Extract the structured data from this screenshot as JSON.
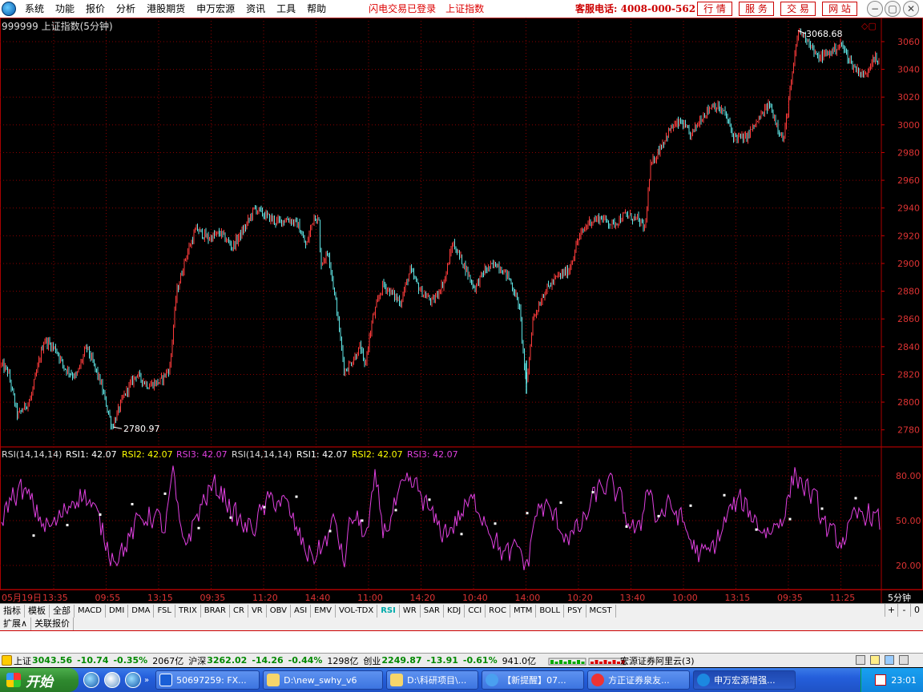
{
  "menu": {
    "items": [
      "系统",
      "功能",
      "报价",
      "分析",
      "港股期货",
      "申万宏源",
      "资讯",
      "工具",
      "帮助"
    ],
    "status_login": "闪电交易已登录",
    "status_index": "上证指数",
    "hotline": "客服电话: 4008-000-562",
    "buttons": [
      "行 情",
      "服 务",
      "交 易",
      "网 站"
    ]
  },
  "chart": {
    "title": "999999 上证指数(5分钟)",
    "high_label": "3068.68",
    "low_label": "2780.97",
    "y_ticks": [
      3060,
      3040,
      3020,
      3000,
      2980,
      2960,
      2940,
      2920,
      2900,
      2880,
      2860,
      2840,
      2820,
      2800,
      2780
    ],
    "x_ticks": [
      "05月19日",
      "13:35",
      "09:55",
      "13:15",
      "09:35",
      "11:20",
      "14:40",
      "11:00",
      "14:20",
      "10:40",
      "14:00",
      "10:20",
      "13:40",
      "10:00",
      "13:15",
      "09:35",
      "11:25"
    ],
    "period_label": "5分钟",
    "colors": {
      "up": "#ff3b3b",
      "down": "#5fe6e6",
      "grid": "#8b0000",
      "rsi": "#e040e0"
    }
  },
  "chart_data": {
    "type": "line",
    "title": "999999 上证指数(5分钟)",
    "ylim": [
      2770,
      3075
    ],
    "x_tick_labels": [
      "05月19日",
      "13:35",
      "09:55",
      "13:15",
      "09:35",
      "11:20",
      "14:40",
      "11:00",
      "14:20",
      "10:40",
      "14:00",
      "10:20",
      "13:40",
      "10:00",
      "13:15",
      "09:35",
      "11:25"
    ],
    "keypoints": [
      [
        0,
        2828
      ],
      [
        10,
        2822
      ],
      [
        22,
        2790
      ],
      [
        38,
        2802
      ],
      [
        55,
        2845
      ],
      [
        70,
        2838
      ],
      [
        80,
        2825
      ],
      [
        95,
        2818
      ],
      [
        108,
        2840
      ],
      [
        125,
        2815
      ],
      [
        140,
        2782
      ],
      [
        155,
        2805
      ],
      [
        170,
        2820
      ],
      [
        185,
        2812
      ],
      [
        200,
        2815
      ],
      [
        212,
        2825
      ],
      [
        220,
        2878
      ],
      [
        232,
        2905
      ],
      [
        245,
        2925
      ],
      [
        260,
        2918
      ],
      [
        275,
        2922
      ],
      [
        290,
        2912
      ],
      [
        305,
        2925
      ],
      [
        318,
        2940
      ],
      [
        330,
        2935
      ],
      [
        345,
        2930
      ],
      [
        360,
        2932
      ],
      [
        372,
        2928
      ],
      [
        382,
        2912
      ],
      [
        392,
        2935
      ],
      [
        398,
        2930
      ],
      [
        400,
        2900
      ],
      [
        410,
        2908
      ],
      [
        420,
        2868
      ],
      [
        430,
        2822
      ],
      [
        440,
        2830
      ],
      [
        450,
        2840
      ],
      [
        455,
        2825
      ],
      [
        465,
        2860
      ],
      [
        478,
        2885
      ],
      [
        490,
        2878
      ],
      [
        500,
        2872
      ],
      [
        512,
        2895
      ],
      [
        525,
        2880
      ],
      [
        540,
        2872
      ],
      [
        555,
        2888
      ],
      [
        565,
        2915
      ],
      [
        580,
        2898
      ],
      [
        592,
        2882
      ],
      [
        605,
        2895
      ],
      [
        620,
        2900
      ],
      [
        635,
        2890
      ],
      [
        648,
        2870
      ],
      [
        657,
        2810
      ],
      [
        665,
        2860
      ],
      [
        680,
        2880
      ],
      [
        695,
        2890
      ],
      [
        710,
        2895
      ],
      [
        722,
        2918
      ],
      [
        735,
        2930
      ],
      [
        750,
        2933
      ],
      [
        765,
        2928
      ],
      [
        780,
        2935
      ],
      [
        795,
        2932
      ],
      [
        805,
        2925
      ],
      [
        812,
        2970
      ],
      [
        825,
        2985
      ],
      [
        838,
        2998
      ],
      [
        850,
        3002
      ],
      [
        862,
        2992
      ],
      [
        875,
        3005
      ],
      [
        890,
        3015
      ],
      [
        905,
        3008
      ],
      [
        915,
        2992
      ],
      [
        930,
        2990
      ],
      [
        945,
        3002
      ],
      [
        960,
        3015
      ],
      [
        970,
        3000
      ],
      [
        978,
        2988
      ],
      [
        985,
        3020
      ],
      [
        990,
        3040
      ],
      [
        996,
        3068
      ],
      [
        1008,
        3062
      ],
      [
        1020,
        3048
      ],
      [
        1035,
        3052
      ],
      [
        1050,
        3058
      ],
      [
        1065,
        3042
      ],
      [
        1080,
        3035
      ],
      [
        1090,
        3050
      ],
      [
        1098,
        3042
      ]
    ],
    "rsi": {
      "params": "RSI(14,14,14)",
      "RSI1": "42.07",
      "RSI2": "42.07",
      "RSI3": "42.07",
      "y_ticks": [
        "80.00",
        "50.00",
        "20.00"
      ],
      "ylim": [
        5,
        95
      ]
    }
  },
  "tabs": [
    "指标",
    "模板",
    "全部",
    "MACD",
    "DMI",
    "DMA",
    "FSL",
    "TRIX",
    "BRAR",
    "CR",
    "VR",
    "OBV",
    "ASI",
    "EMV",
    "VOL-TDX",
    "RSI",
    "WR",
    "SAR",
    "KDJ",
    "CCI",
    "ROC",
    "MTM",
    "BOLL",
    "PSY",
    "MCST"
  ],
  "active_tab": "RSI",
  "tab_controls": [
    "+",
    "-",
    "0"
  ],
  "subtabs": [
    "扩展∧",
    "关联报价"
  ],
  "statusbar": {
    "quotes": [
      {
        "name": "上证",
        "price": "3043.56",
        "change": "-10.74",
        "pct": "-0.35%",
        "amount": "2067亿"
      },
      {
        "name": "沪深",
        "price": "3262.02",
        "change": "-14.26",
        "pct": "-0.44%",
        "amount": "1298亿"
      },
      {
        "name": "创业",
        "price": "2249.87",
        "change": "-13.91",
        "pct": "-0.61%",
        "amount": "941.0亿"
      }
    ],
    "server": "宏源证券阿里云(3)"
  },
  "taskbar": {
    "start": "开始",
    "windows": [
      {
        "label": "50697259: FX...",
        "active": false
      },
      {
        "label": "D:\\new_swhy_v6",
        "active": false
      },
      {
        "label": "D:\\科研项目\\...",
        "active": false
      },
      {
        "label": "【新提醒】07...",
        "active": false
      },
      {
        "label": "方正证券泉友...",
        "active": false
      },
      {
        "label": "申万宏源增强...",
        "active": true
      }
    ],
    "clock": "23:01"
  }
}
